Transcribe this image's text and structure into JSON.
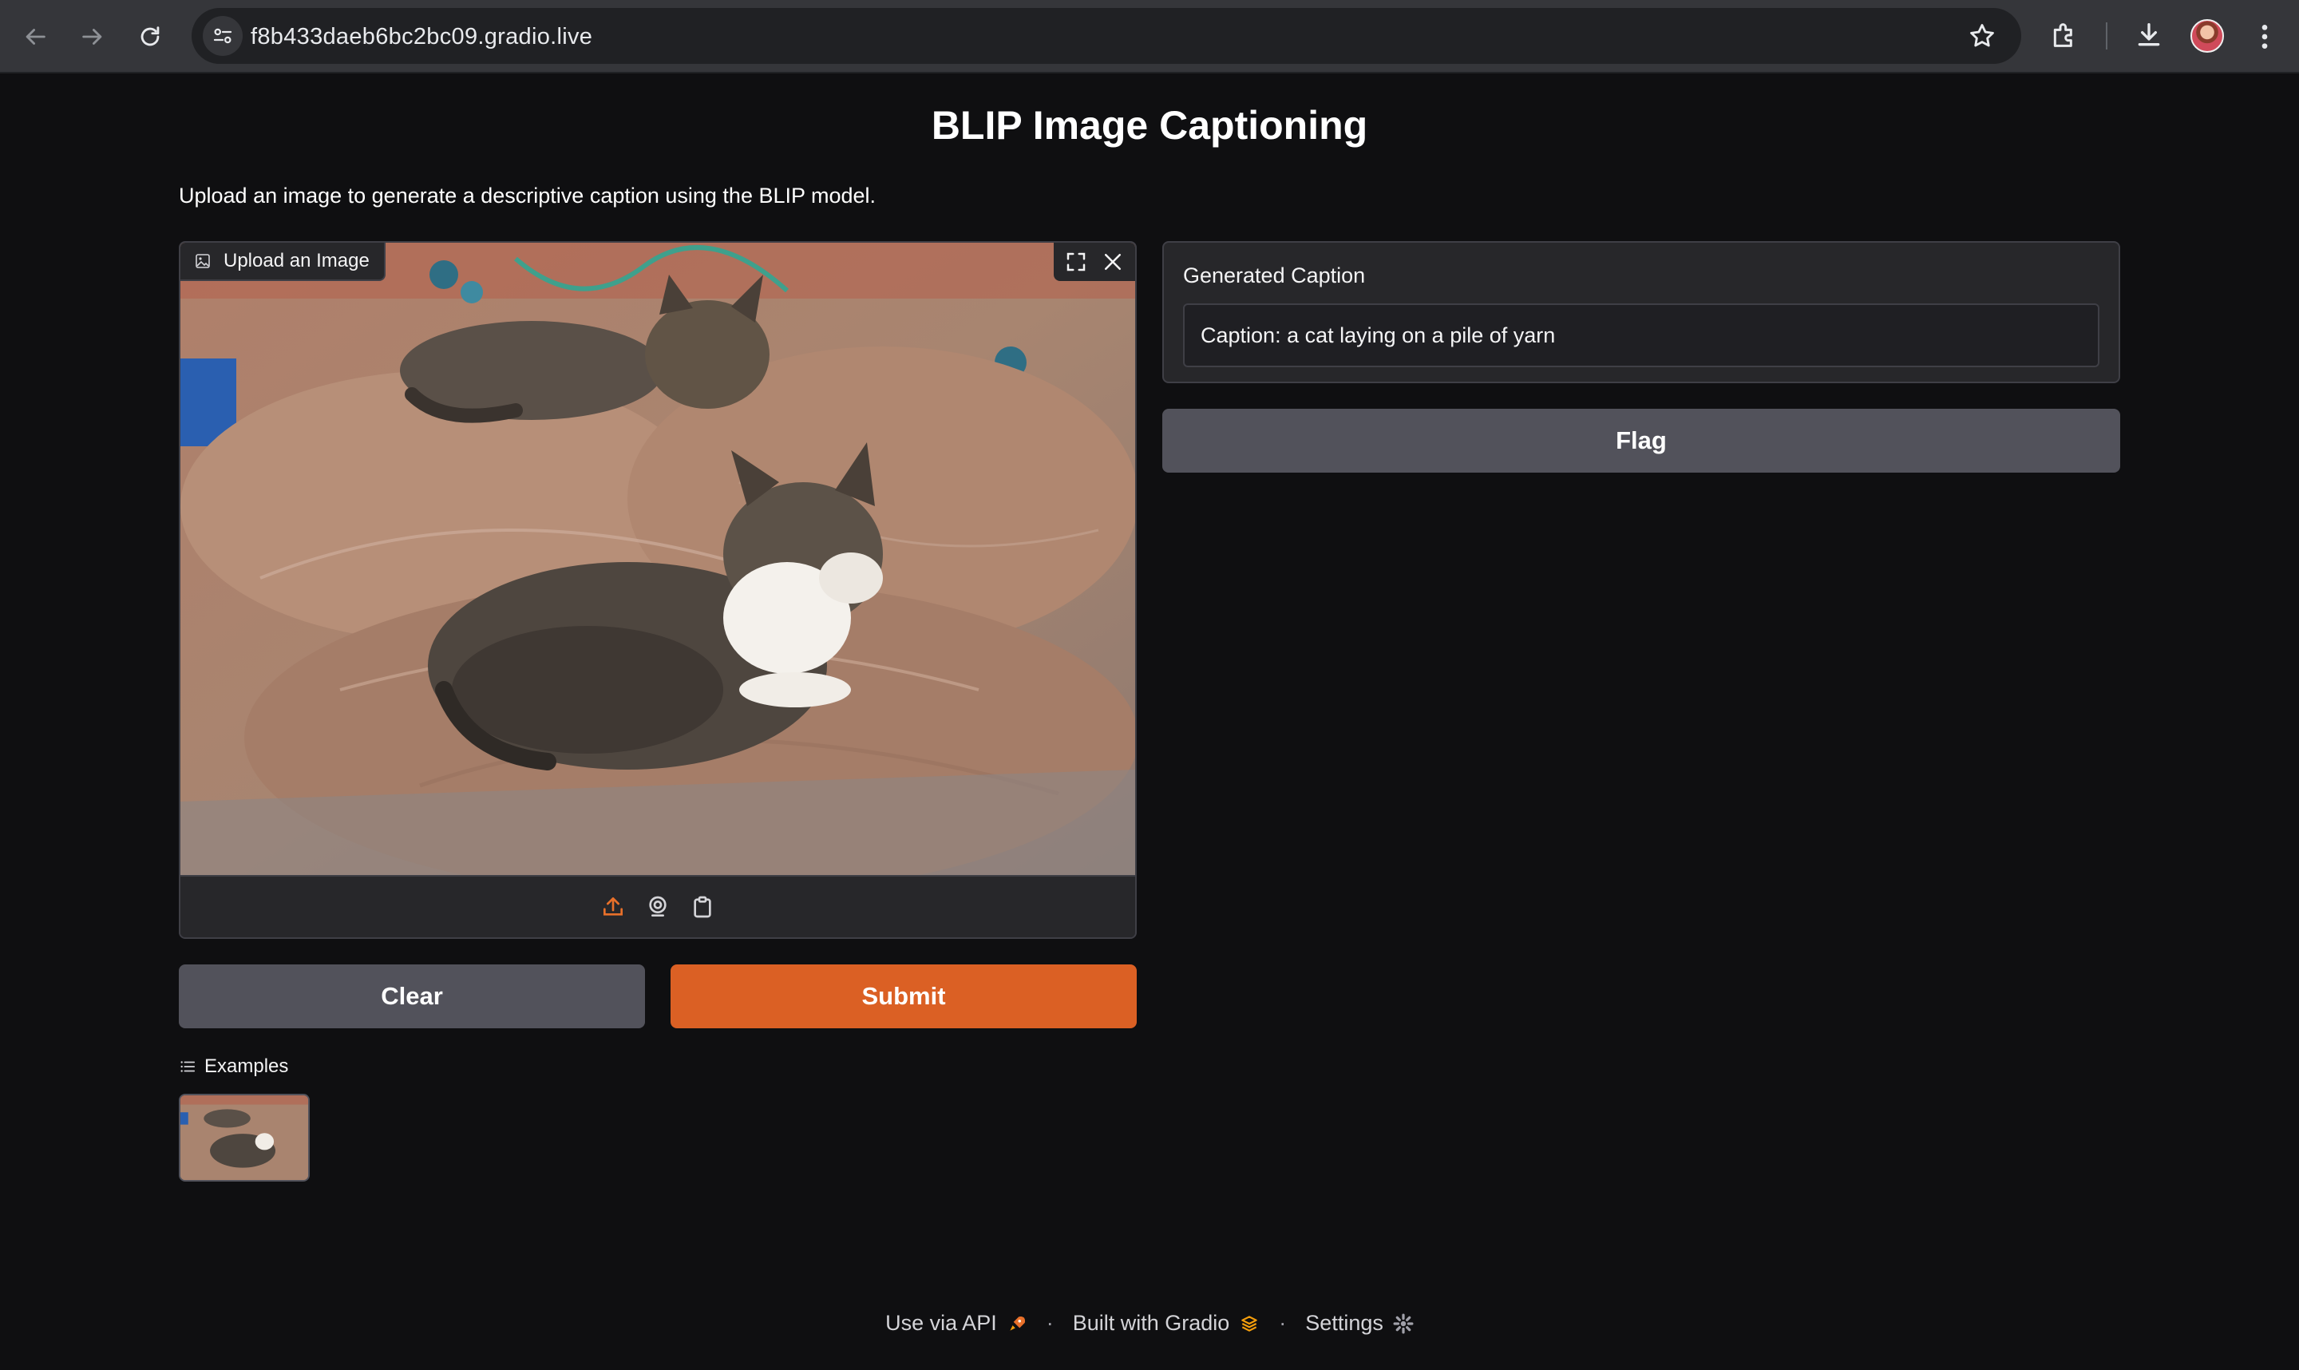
{
  "browser": {
    "url": "f8b433daeb6bc2bc09.gradio.live",
    "icons": [
      "back-arrow-icon",
      "forward-arrow-icon",
      "reload-icon",
      "site-info-icon",
      "star-icon",
      "extensions-icon",
      "download-icon",
      "avatar",
      "more-options-icon"
    ]
  },
  "page": {
    "title": "BLIP Image Captioning",
    "description": "Upload an image to generate a descriptive caption using the BLIP model."
  },
  "image_input": {
    "label": "Upload an Image",
    "icons": [
      "image-icon",
      "fullscreen-icon",
      "close-icon",
      "upload-icon",
      "webcam-icon",
      "clipboard-icon"
    ]
  },
  "buttons": {
    "clear": "Clear",
    "submit": "Submit",
    "flag": "Flag"
  },
  "examples": {
    "label": "Examples"
  },
  "output": {
    "label": "Generated Caption",
    "value": "Caption: a cat laying on a pile of yarn"
  },
  "footer": {
    "api": "Use via API",
    "built": "Built with Gradio",
    "settings": "Settings"
  },
  "colors": {
    "accent": "#db6024",
    "secondary_button": "#52525b",
    "background": "#0f0f11",
    "panel": "#27272a"
  }
}
